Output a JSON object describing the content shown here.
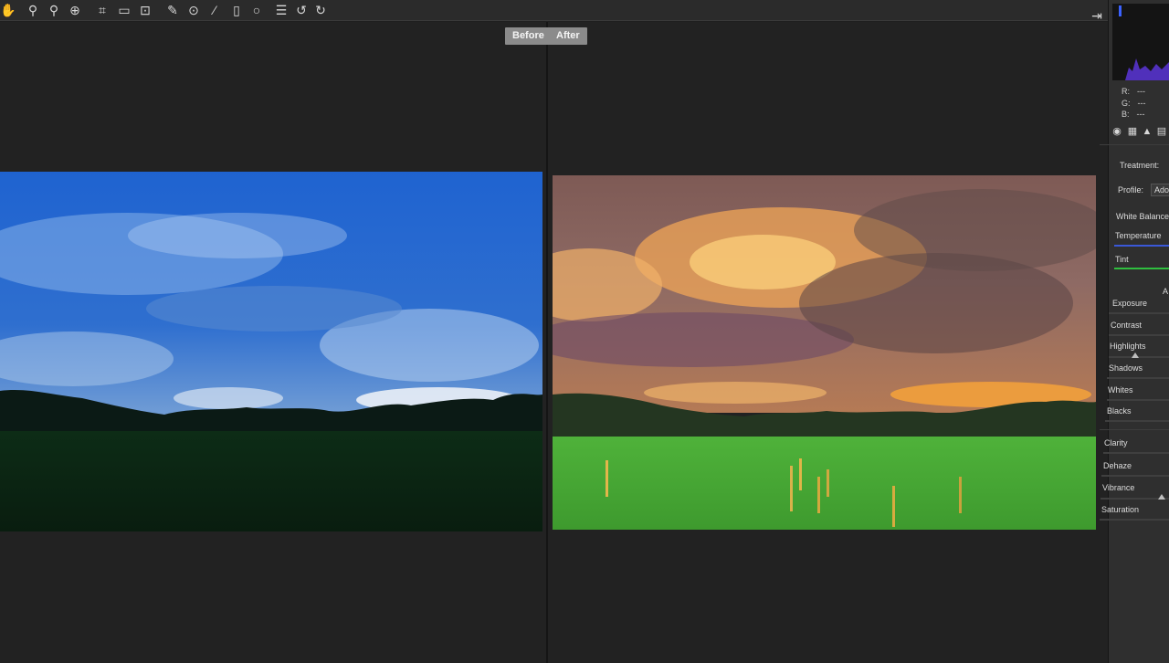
{
  "toolbar": {
    "tools": [
      "hand-icon",
      "white-balance-icon",
      "color-sampler-icon",
      "targeted-adjustment-icon",
      "crop-icon",
      "straighten-icon",
      "transform-icon",
      "spot-removal-icon",
      "red-eye-icon",
      "adjustment-brush-icon",
      "graduated-filter-icon",
      "radial-filter-icon",
      "presets-list-icon",
      "rotate-left-icon",
      "rotate-right-icon"
    ]
  },
  "compare": {
    "before_label": "Before",
    "after_label": "After"
  },
  "histogram": {
    "r_label": "R:",
    "r_value": "---",
    "g_label": "G:",
    "g_value": "---",
    "b_label": "B:",
    "b_value": "---"
  },
  "basic_panel": {
    "treatment_label": "Treatment:",
    "profile_label": "Profile:",
    "profile_value": "Ado",
    "white_balance_label": "White Balance:",
    "temperature_label": "Temperature",
    "tint_label": "Tint",
    "auto_label": "A",
    "exposure_label": "Exposure",
    "contrast_label": "Contrast",
    "highlights_label": "Highlights",
    "shadows_label": "Shadows",
    "whites_label": "Whites",
    "blacks_label": "Blacks",
    "clarity_label": "Clarity",
    "dehaze_label": "Dehaze",
    "vibrance_label": "Vibrance",
    "saturation_label": "Saturation"
  },
  "colors": {
    "temperature_track": "#3a58d8",
    "tint_track": "#2fbf3f"
  }
}
